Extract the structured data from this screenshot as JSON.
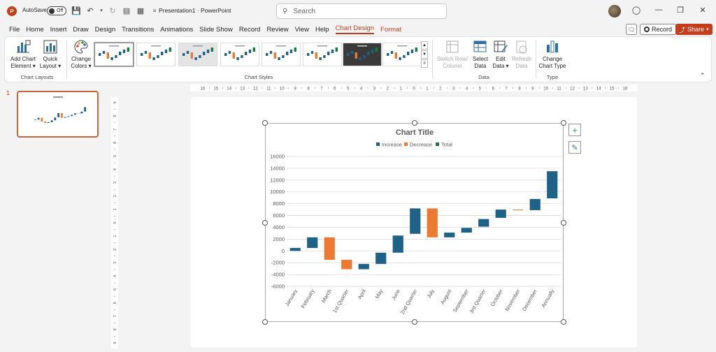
{
  "titlebar": {
    "autosave_label": "AutoSave",
    "autosave_state": "Off",
    "doc_title": "Presentation1 · PowerPoint",
    "search_placeholder": "Search"
  },
  "tabs": [
    "File",
    "Home",
    "Insert",
    "Draw",
    "Design",
    "Transitions",
    "Animations",
    "Slide Show",
    "Record",
    "Review",
    "View",
    "Help",
    "Chart Design",
    "Format"
  ],
  "tab_active": "Chart Design",
  "tab_actions": {
    "record_label": "Record",
    "share_label": "Share"
  },
  "ribbon": {
    "add_chart_element": [
      "Add Chart",
      "Element ▾"
    ],
    "quick_layout": [
      "Quick",
      "Layout ▾"
    ],
    "chart_layouts_label": "Chart Layouts",
    "change_colors": [
      "Change",
      "Colors ▾"
    ],
    "chart_styles_label": "Chart Styles",
    "switch_row_column": [
      "Switch Row/",
      "Column"
    ],
    "select_data": [
      "Select",
      "Data"
    ],
    "edit_data": [
      "Edit",
      "Data ▾"
    ],
    "refresh_data": [
      "Refresh",
      "Data"
    ],
    "data_label": "Data",
    "change_chart_type": [
      "Change",
      "Chart Type"
    ],
    "type_label": "Type"
  },
  "slides_panel": {
    "slide_number": "1"
  },
  "ruler": {
    "horizontal_ticks": [
      "16",
      "15",
      "14",
      "13",
      "12",
      "11",
      "10",
      "9",
      "8",
      "7",
      "6",
      "5",
      "4",
      "3",
      "2",
      "1",
      "0",
      "1",
      "2",
      "3",
      "4",
      "5",
      "6",
      "7",
      "8",
      "9",
      "10",
      "11",
      "12",
      "13",
      "14",
      "15",
      "16"
    ],
    "vertical_ticks": [
      "9",
      "8",
      "7",
      "6",
      "5",
      "4",
      "3",
      "2",
      "1",
      "0",
      "1",
      "2",
      "3",
      "4",
      "5",
      "6",
      "7",
      "8",
      "9"
    ]
  },
  "colors": {
    "increase": "#1f6288",
    "decrease": "#ec7a32",
    "total": "#1e7a3c",
    "accent": "#c43e1c"
  },
  "chart_data": {
    "type": "bar",
    "subtype": "waterfall",
    "title": "Chart Title",
    "legend": [
      "Increase",
      "Decrease",
      "Total"
    ],
    "legend_position": "top",
    "ylim": [
      -6000,
      16000
    ],
    "yticks": [
      16000,
      14000,
      12000,
      10000,
      8000,
      6000,
      4000,
      2000,
      0,
      -2000,
      -4000,
      -6000
    ],
    "grid": true,
    "categories": [
      "January",
      "February",
      "March",
      "1st Quarter",
      "April",
      "May",
      "June",
      "2nd Quarter",
      "July",
      "August",
      "September",
      "3rd Quarter",
      "October",
      "November",
      "December",
      "Annually"
    ],
    "bars": [
      {
        "start": 0,
        "end": 500,
        "kind": "increase"
      },
      {
        "start": 500,
        "end": 2300,
        "kind": "increase"
      },
      {
        "start": 2300,
        "end": -1500,
        "kind": "decrease"
      },
      {
        "start": -1500,
        "end": -3100,
        "kind": "decrease"
      },
      {
        "start": -3100,
        "end": -2200,
        "kind": "increase"
      },
      {
        "start": -2200,
        "end": -300,
        "kind": "increase"
      },
      {
        "start": -300,
        "end": 2600,
        "kind": "increase"
      },
      {
        "start": 2900,
        "end": 7200,
        "kind": "increase"
      },
      {
        "start": 7200,
        "end": 2300,
        "kind": "decrease"
      },
      {
        "start": 2300,
        "end": 3100,
        "kind": "increase"
      },
      {
        "start": 3100,
        "end": 3900,
        "kind": "increase"
      },
      {
        "start": 4100,
        "end": 5400,
        "kind": "increase"
      },
      {
        "start": 5600,
        "end": 7000,
        "kind": "increase"
      },
      {
        "start": 7000,
        "end": 6900,
        "kind": "decrease"
      },
      {
        "start": 6900,
        "end": 8800,
        "kind": "increase"
      },
      {
        "start": 8900,
        "end": 13500,
        "kind": "increase"
      }
    ]
  }
}
